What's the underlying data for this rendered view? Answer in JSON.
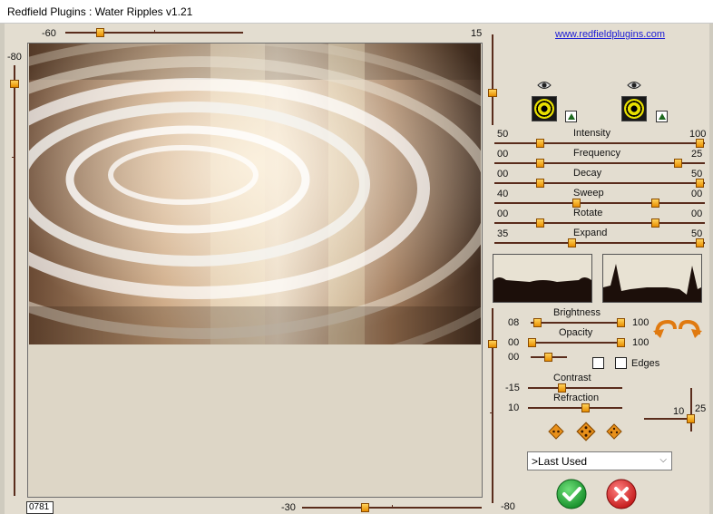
{
  "window": {
    "title": "Redfield Plugins : Water Ripples v1.21"
  },
  "link": "www.redfieldplugins.com",
  "top_slider": {
    "left_value": "-60",
    "right_value": "15"
  },
  "left_slider": {
    "value": "-80"
  },
  "bottom_slider": {
    "value": "-30"
  },
  "right_slider": {
    "value": "-80"
  },
  "frame_number": "0781",
  "params": {
    "intensity": {
      "label": "Intensity",
      "left": "50",
      "right": "100"
    },
    "frequency": {
      "label": "Frequency",
      "left": "00",
      "right": "25"
    },
    "decay": {
      "label": "Decay",
      "left": "00",
      "right": "50"
    },
    "sweep": {
      "label": "Sweep",
      "left": "40",
      "right": "00"
    },
    "rotate": {
      "label": "Rotate",
      "left": "00",
      "right": "00"
    },
    "expand": {
      "label": "Expand",
      "left": "35",
      "right": "50"
    }
  },
  "brightness": {
    "label": "Brightness",
    "left": "08",
    "right": "100"
  },
  "opacity": {
    "label": "Opacity",
    "left": "00",
    "right": "100"
  },
  "third": {
    "left": "00"
  },
  "edges": {
    "label": "Edges"
  },
  "contrast": {
    "label": "Contrast",
    "value": "-15"
  },
  "refraction": {
    "label": "Refraction",
    "value": "10"
  },
  "light": {
    "left": "10",
    "right": "25"
  },
  "preset": {
    "selected": ">Last Used"
  },
  "icons": {
    "eye_left": "eye-icon",
    "eye_right": "eye-icon",
    "ok": "checkmark-icon",
    "cancel": "x-icon",
    "random": "dice-icon"
  },
  "colors": {
    "track": "#5a2c1c",
    "knob": "#f0a010",
    "link": "#1b1bd6",
    "ok": "#1ea83a",
    "cancel": "#d42a2a"
  }
}
